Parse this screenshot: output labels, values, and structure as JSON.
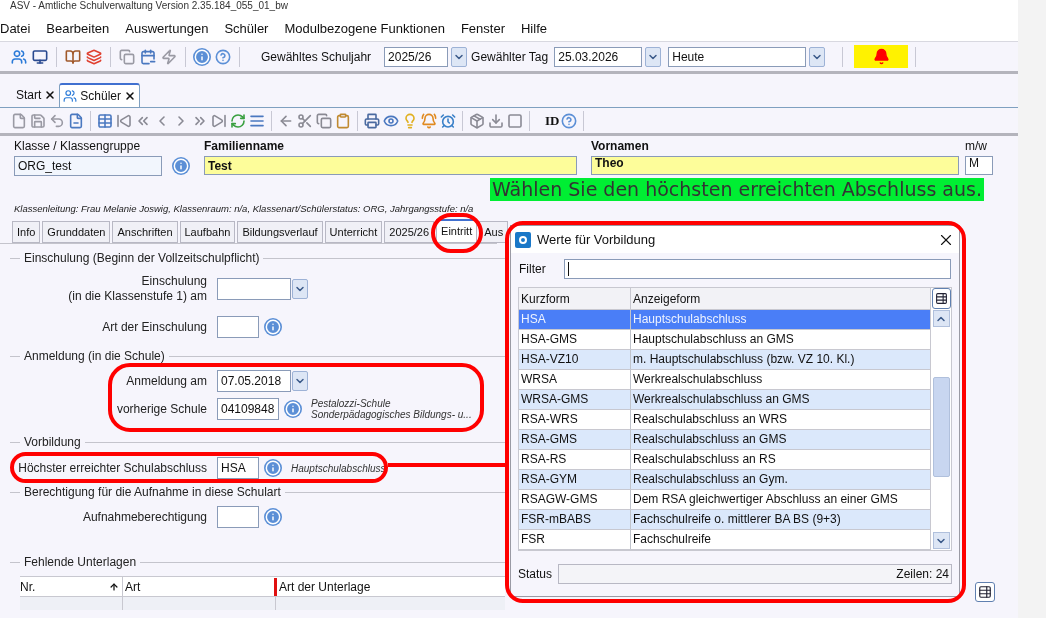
{
  "window": {
    "title": "ASV - Amtliche Schulverwaltung Version 2.35.184_055_01_bw"
  },
  "menu": [
    "Datei",
    "Bearbeiten",
    "Auswertungen",
    "Schüler",
    "Modulbezogene Funktionen",
    "Fenster",
    "Hilfe"
  ],
  "toolbar": {
    "schuljahr_label": "Gewähltes Schuljahr",
    "schuljahr": "2025/26",
    "tag_label": "Gewählter Tag",
    "tag": "25.03.2026",
    "modus": "Heute"
  },
  "doc_tabs": [
    {
      "label": "Start",
      "selected": false
    },
    {
      "label": "Schüler",
      "selected": true
    }
  ],
  "toolbar2": {
    "id_label": "ID"
  },
  "header": {
    "klasse_label": "Klasse / Klassengruppe",
    "klasse": "ORG_test",
    "familienname_label": "Familienname",
    "familienname": "Test",
    "vornamen_label": "Vornamen",
    "vornamen": "Theo",
    "geschlecht_label": "m/w",
    "geschlecht": "M",
    "info": "Klassenleitung: Frau Melanie Joswig, Klassenraum: n/a, Klassenart/Schülerstatus: ORG, Jahrgangsstufe: n/a"
  },
  "tabs": [
    {
      "label": "Info",
      "selected": false
    },
    {
      "label": "Grunddaten",
      "selected": false
    },
    {
      "label": "Anschriften",
      "selected": false
    },
    {
      "label": "Laufbahn",
      "selected": false
    },
    {
      "label": "Bildungsverlauf",
      "selected": false
    },
    {
      "label": "Unterricht",
      "selected": false
    },
    {
      "label": "2025/26",
      "selected": false
    },
    {
      "label": "Eintritt",
      "selected": true
    },
    {
      "label": "Aus",
      "selected": false
    }
  ],
  "sections": [
    {
      "title": "Einschulung (Beginn der Vollzeitschulpflicht)",
      "fields": [
        {
          "kind": "combo",
          "label": "Einschulung",
          "label2": "(in die Klassenstufe 1) am"
        },
        {
          "kind": "code",
          "label": "Art der Einschulung"
        }
      ]
    },
    {
      "title": "Anmeldung (in die Schule)",
      "fields": [
        {
          "kind": "combo",
          "label": "Anmeldung am",
          "value": "07.05.2018"
        },
        {
          "kind": "code",
          "label": "vorherige Schule",
          "value": "04109848",
          "note": "Pestalozzi-Schule",
          "note2": "Sonderpädagogisches Bildungs- u..."
        }
      ]
    },
    {
      "title": "Vorbildung",
      "fields": [
        {
          "kind": "code",
          "label": "Höchster erreichter Schulabschluss",
          "value": "HSA",
          "note": "Hauptschulabschluss"
        }
      ]
    },
    {
      "title": "Berechtigung für die Aufnahme in diese Schulart",
      "fields": [
        {
          "kind": "code",
          "label": "Aufnahmeberechtigung"
        }
      ]
    }
  ],
  "fehlende_unterlagen": {
    "title": "Fehlende Unterlagen",
    "columns": [
      "Nr.",
      "Art",
      "Art der Unterlage"
    ]
  },
  "dialog": {
    "title": "Werte für Vorbildung",
    "filter_label": "Filter",
    "columns": [
      "Kurzform",
      "Anzeigeform"
    ],
    "rows": [
      {
        "kurzform": "HSA",
        "anzeigeform": "Hauptschulabschluss",
        "selected": true
      },
      {
        "kurzform": "HSA-GMS",
        "anzeigeform": "Hauptschulabschluss an GMS",
        "selected": false
      },
      {
        "kurzform": "HSA-VZ10",
        "anzeigeform": "m. Hauptschulabschluss (bzw. VZ 10. Kl.)",
        "selected": false
      },
      {
        "kurzform": "WRSA",
        "anzeigeform": "Werkrealschulabschluss",
        "selected": false
      },
      {
        "kurzform": "WRSA-GMS",
        "anzeigeform": "Werkrealschulabschluss an GMS",
        "selected": false
      },
      {
        "kurzform": "RSA-WRS",
        "anzeigeform": "Realschulabschluss an WRS",
        "selected": false
      },
      {
        "kurzform": "RSA-GMS",
        "anzeigeform": "Realschulabschluss an GMS",
        "selected": false
      },
      {
        "kurzform": "RSA-RS",
        "anzeigeform": "Realschulabschluss an RS",
        "selected": false
      },
      {
        "kurzform": "RSA-GYM",
        "anzeigeform": "Realschulabschluss an Gym.",
        "selected": false
      },
      {
        "kurzform": "RSAGW-GMS",
        "anzeigeform": "Dem RSA gleichwertiger Abschluss an einer GMS",
        "selected": false
      },
      {
        "kurzform": "FSR-mBABS",
        "anzeigeform": "Fachschulreife o. mittlerer BA BS (9+3)",
        "selected": false
      },
      {
        "kurzform": "FSR",
        "anzeigeform": "Fachschulreife",
        "selected": false
      }
    ],
    "status_label": "Status",
    "rows_count": "Zeilen: 24"
  },
  "annotations": {
    "caption": "Wählen Sie den höchsten erreichten Abschluss aus."
  }
}
